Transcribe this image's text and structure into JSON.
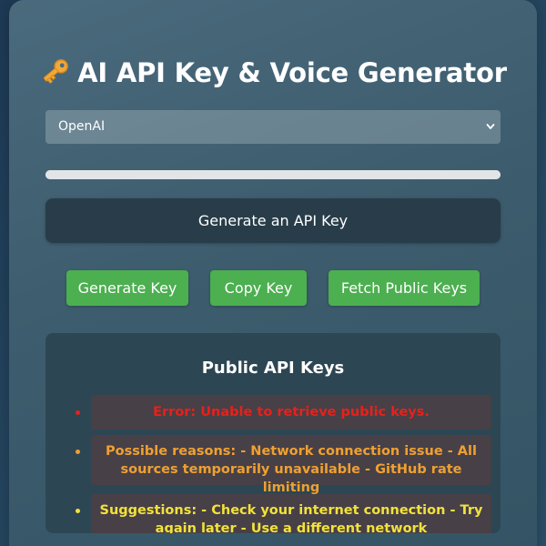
{
  "header": {
    "title": "AI API Key & Voice Generator",
    "icon": "key-icon"
  },
  "provider_select": {
    "selected": "OpenAI"
  },
  "progress": {
    "value": 1.0
  },
  "status": {
    "text": "Generate an API Key"
  },
  "actions": {
    "generate_label": "Generate Key",
    "copy_label": "Copy Key",
    "fetch_label": "Fetch Public Keys"
  },
  "public_keys": {
    "title": "Public API Keys",
    "error": "Error: Unable to retrieve public keys.",
    "reasons": "Possible reasons: - Network connection issue - All sources temporarily unavailable - GitHub rate limiting",
    "suggestions": "Suggestions: - Check your internet connection - Try again later - Use a different network"
  },
  "colors": {
    "button_green": "#4caf50",
    "error_red": "#e8201a",
    "warning_orange": "#f0a030",
    "suggestion_yellow": "#f2e23a"
  }
}
